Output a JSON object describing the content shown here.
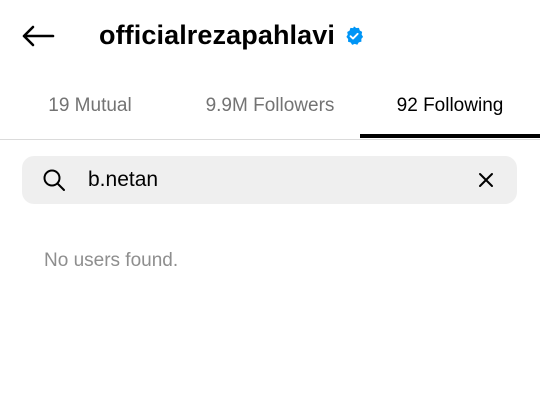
{
  "header": {
    "back_icon": "arrow-left-icon",
    "username": "officialrezapahlavi",
    "verified_icon": "verified-badge-icon",
    "verified_color": "#0095f6"
  },
  "tabs": [
    {
      "label": "19 Mutual",
      "active": false
    },
    {
      "label": "9.9M Followers",
      "active": false
    },
    {
      "label": "92 Following",
      "active": true
    }
  ],
  "search": {
    "icon": "search-icon",
    "value": "b.netan",
    "clear_icon": "close-icon"
  },
  "results": {
    "empty_message": "No users found."
  },
  "colors": {
    "text_primary": "#000000",
    "text_secondary": "#737373",
    "text_muted": "#8e8e8e",
    "search_bg": "#efefef",
    "divider": "#dbdbdb"
  }
}
